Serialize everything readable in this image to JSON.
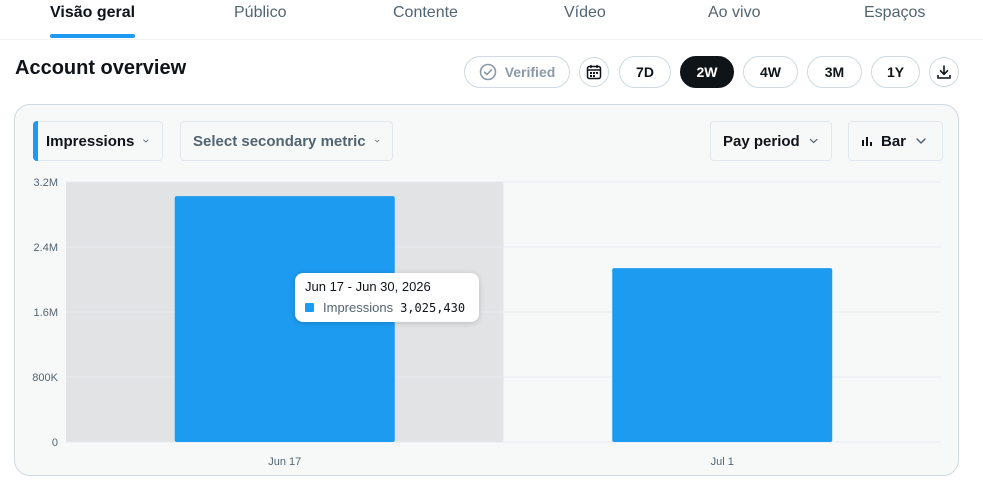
{
  "tabs": [
    {
      "label": "Visão geral",
      "active": true
    },
    {
      "label": "Público",
      "active": false
    },
    {
      "label": "Contente",
      "active": false
    },
    {
      "label": "Vídeo",
      "active": false
    },
    {
      "label": "Ao vivo",
      "active": false
    },
    {
      "label": "Espaços",
      "active": false
    }
  ],
  "header": {
    "title": "Account overview",
    "verified_label": "Verified",
    "calendar_icon": "calendar-icon",
    "download_icon": "download-icon",
    "ranges": [
      {
        "label": "7D",
        "selected": false
      },
      {
        "label": "2W",
        "selected": true
      },
      {
        "label": "4W",
        "selected": false
      },
      {
        "label": "3M",
        "selected": false
      },
      {
        "label": "1Y",
        "selected": false
      }
    ]
  },
  "controls": {
    "primary_metric": "Impressions",
    "secondary_metric_placeholder": "Select secondary metric",
    "period": "Pay period",
    "chart_type": "Bar"
  },
  "colors": {
    "accent": "#1d9bf0",
    "highlight_band": "#e1e3e5",
    "dark": "#0f1419",
    "muted": "#536471"
  },
  "chart_data": {
    "type": "bar",
    "categories": [
      "Jun 17",
      "Jul 1"
    ],
    "series": [
      {
        "name": "Impressions",
        "values": [
          3025430,
          2140000
        ]
      }
    ],
    "y_ticks": [
      "0",
      "800K",
      "1.6M",
      "2.4M",
      "3.2M"
    ],
    "ylim": [
      0,
      3200000
    ],
    "grid": true,
    "highlighted_category": "Jun 17"
  },
  "tooltip": {
    "title": "Jun 17 - Jun 30, 2026",
    "series_name": "Impressions",
    "value": "3,025,430"
  }
}
